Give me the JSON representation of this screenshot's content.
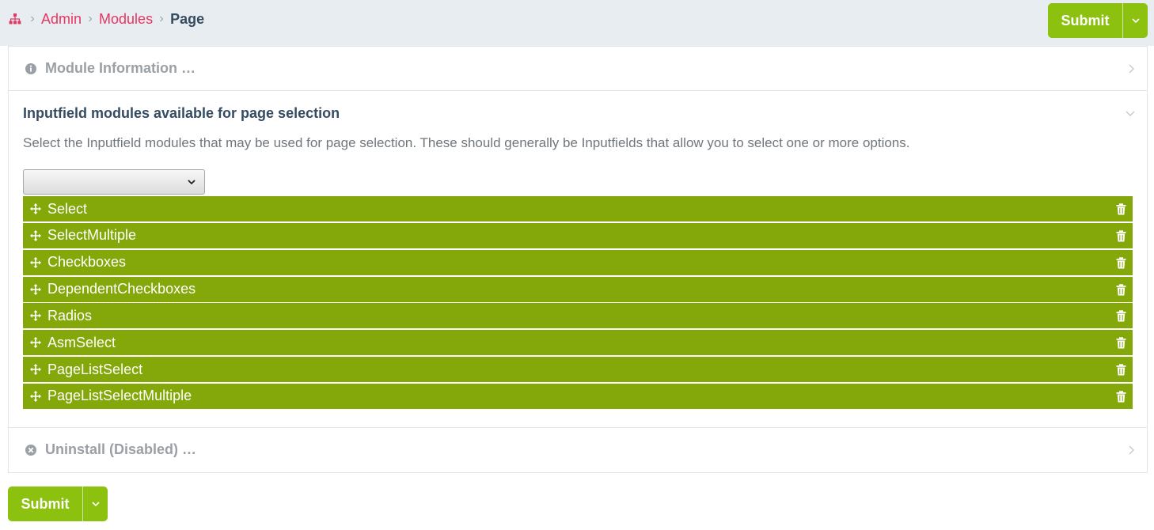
{
  "breadcrumb": {
    "home_icon": "sitemap-icon",
    "items": [
      "Admin",
      "Modules"
    ],
    "current": "Page"
  },
  "submit": {
    "label": "Submit"
  },
  "panels": {
    "module_info": {
      "title": "Module Information …",
      "icon": "info-circle-icon"
    },
    "inputfield": {
      "title": "Inputfield modules available for page selection",
      "description": "Select the Inputfield modules that may be used for page selection. These should generally be Inputfields that allow you to select one or more options.",
      "select_value": "",
      "items": [
        "Select",
        "SelectMultiple",
        "Checkboxes",
        "DependentCheckboxes",
        "Radios",
        "AsmSelect",
        "PageListSelect",
        "PageListSelectMultiple"
      ]
    },
    "uninstall": {
      "title": "Uninstall (Disabled) …",
      "icon": "times-circle-icon"
    }
  },
  "colors": {
    "accent_link": "#e83561",
    "submit_green": "#8cc20f",
    "item_green": "#84a80a",
    "header_bg": "#e7edf1"
  }
}
